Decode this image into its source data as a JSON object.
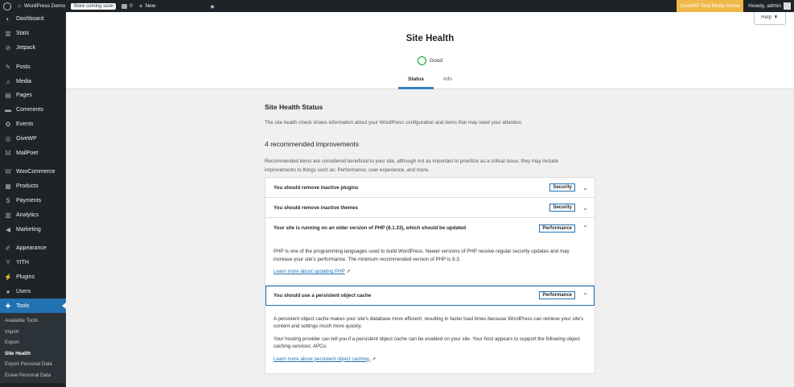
{
  "adminbar": {
    "site_name": "WordPress Demo",
    "store_badge": "Store coming soon",
    "comments_count": "0",
    "new_label": "New",
    "givewp_notice": "GiveWP Test Mode Active",
    "howdy": "Howdy, admin"
  },
  "help_label": "Help ▼",
  "menu": [
    {
      "label": "Dashboard",
      "icon": "dashboard-icon",
      "glyph": "◐"
    },
    {
      "label": "Stats",
      "icon": "stats-icon",
      "glyph": "▥"
    },
    {
      "label": "Jetpack",
      "icon": "jetpack-icon",
      "glyph": "⊘"
    },
    {
      "label": "Posts",
      "icon": "pin-icon",
      "glyph": "✎"
    },
    {
      "label": "Media",
      "icon": "media-icon",
      "glyph": "♫"
    },
    {
      "label": "Pages",
      "icon": "pages-icon",
      "glyph": "▤"
    },
    {
      "label": "Comments",
      "icon": "comments-icon",
      "glyph": "▬"
    },
    {
      "label": "Events",
      "icon": "events-icon",
      "glyph": "✿"
    },
    {
      "label": "GiveWP",
      "icon": "givewp-icon",
      "glyph": "◎"
    },
    {
      "label": "MailPoet",
      "icon": "mailpoet-icon",
      "glyph": "M"
    },
    {
      "label": "WooCommerce",
      "icon": "woocommerce-icon",
      "glyph": "W"
    },
    {
      "label": "Products",
      "icon": "products-icon",
      "glyph": "▦"
    },
    {
      "label": "Payments",
      "icon": "payments-icon",
      "glyph": "$"
    },
    {
      "label": "Analytics",
      "icon": "analytics-icon",
      "glyph": "▥"
    },
    {
      "label": "Marketing",
      "icon": "marketing-icon",
      "glyph": "◀"
    },
    {
      "label": "Appearance",
      "icon": "appearance-icon",
      "glyph": "✐"
    },
    {
      "label": "YITH",
      "icon": "yith-icon",
      "glyph": "Y"
    },
    {
      "label": "Plugins",
      "icon": "plugins-icon",
      "glyph": "⚡"
    },
    {
      "label": "Users",
      "icon": "users-icon",
      "glyph": "●"
    },
    {
      "label": "Tools",
      "icon": "tools-icon",
      "glyph": "✚"
    }
  ],
  "submenu": [
    "Available Tools",
    "Import",
    "Export",
    "Site Health",
    "Export Personal Data",
    "Erase Personal Data"
  ],
  "page": {
    "title": "Site Health",
    "status": "Good",
    "tabs": [
      "Status",
      "Info"
    ]
  },
  "content": {
    "heading": "Site Health Status",
    "intro": "The site health check shows information about your WordPress configuration and items that may need your attention.",
    "recommend_heading": "4 recommended improvements",
    "recommend_text": "Recommended items are considered beneficial to your site, although not as important to prioritize as a critical issue, they may include improvements to things such as; Performance, user experience, and more."
  },
  "items": [
    {
      "title": "You should remove inactive plugins",
      "tag": "Security"
    },
    {
      "title": "You should remove inactive themes",
      "tag": "Security"
    },
    {
      "title": "Your site is running on an older version of PHP (8.1.33), which should be updated",
      "tag": "Performance"
    },
    {
      "title": "You should use a persistent object cache",
      "tag": "Performance"
    }
  ],
  "php_panel": {
    "text": "PHP is one of the programming languages used to build WordPress. Newer versions of PHP receive regular security updates and may increase your site's performance. The minimum recommended version of PHP is 8.3.",
    "link": "Learn more about updating PHP"
  },
  "cache_panel": {
    "text1": "A persistent object cache makes your site's database more efficient, resulting in faster load times because WordPress can retrieve your site's content and settings much more quickly.",
    "text2": "Your hosting provider can tell you if a persistent object cache can be enabled on your site. Your host appears to support the following object caching services: APCu.",
    "link": "Learn more about persistent object caching."
  },
  "colors": {
    "accent": "#2271b1",
    "good": "#00a32a",
    "notice": "#f0b849"
  }
}
